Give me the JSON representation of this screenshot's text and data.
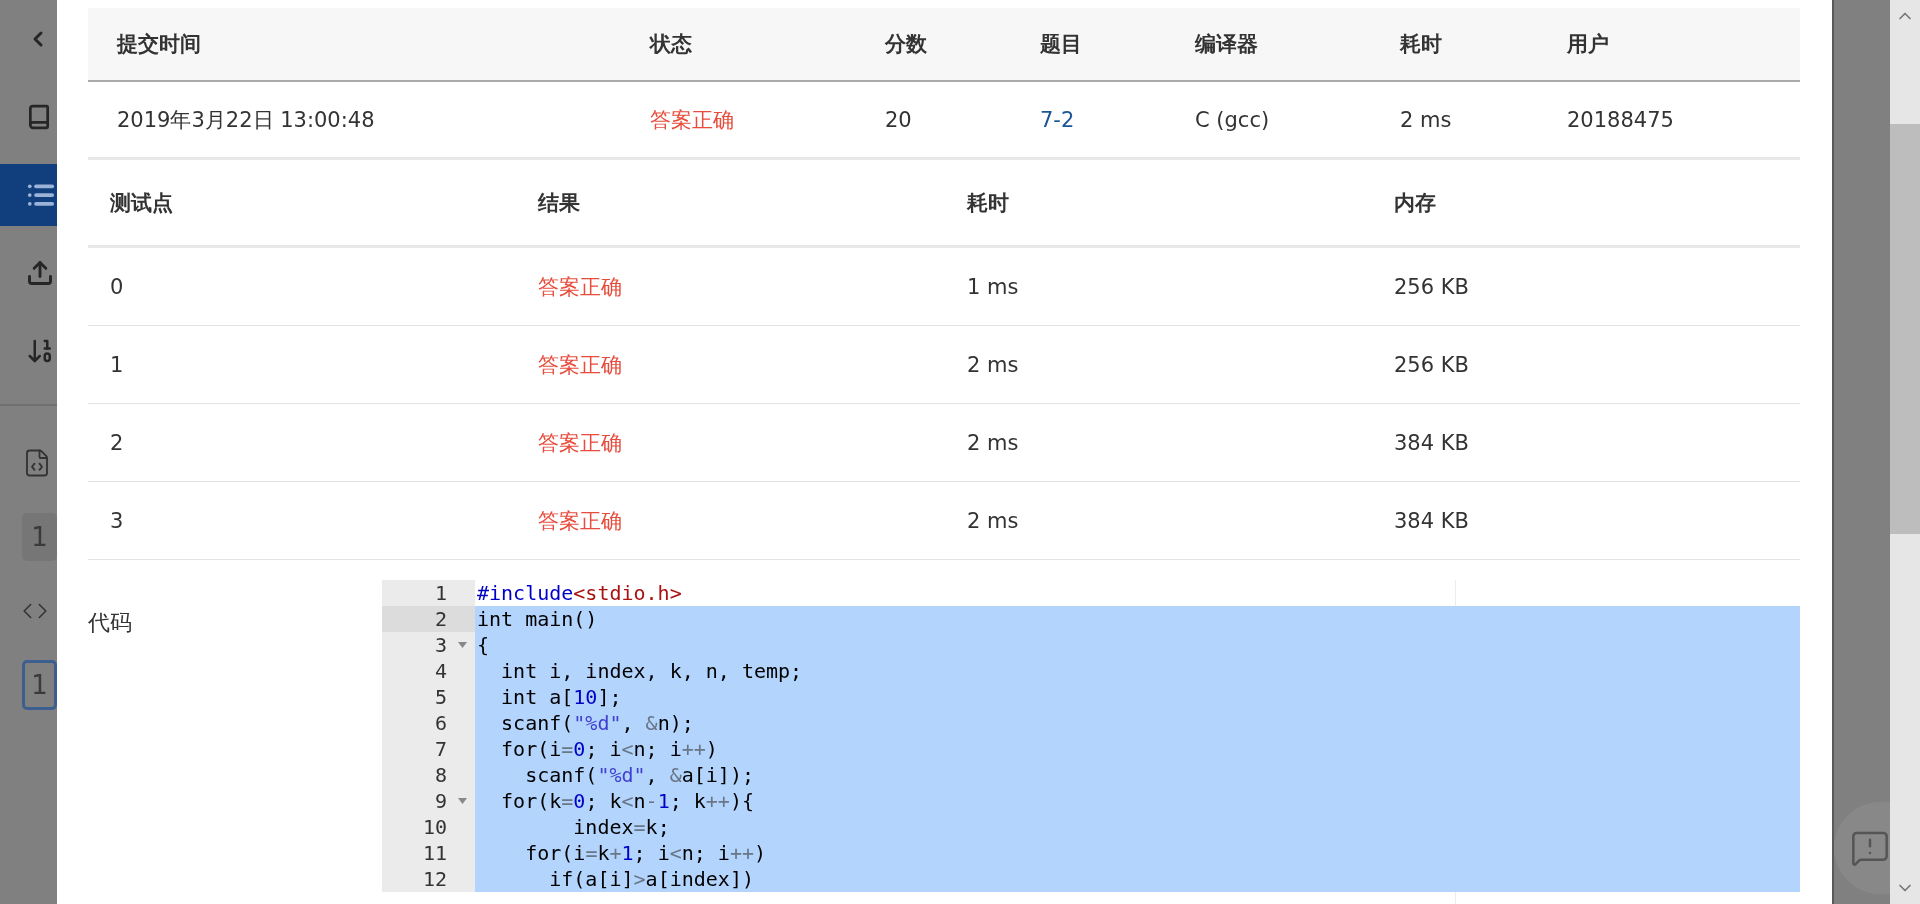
{
  "sidebar": {
    "items": [
      {
        "kind": "back",
        "selected": false
      },
      {
        "kind": "book",
        "selected": false
      },
      {
        "kind": "list",
        "selected": true
      },
      {
        "kind": "upload",
        "selected": false
      },
      {
        "kind": "sort",
        "selected": false
      }
    ],
    "lower_items": [
      {
        "kind": "file-code"
      },
      {
        "kind": "count",
        "label": "1",
        "selected": false
      },
      {
        "kind": "code"
      },
      {
        "kind": "count",
        "label": "1",
        "selected": true
      }
    ]
  },
  "submission_table": {
    "columns": [
      "提交时间",
      "状态",
      "分数",
      "题目",
      "编译器",
      "耗时",
      "用户"
    ],
    "rows": [
      {
        "cells": [
          {
            "kind": "text",
            "text": "2019年3月22日 13:00:48"
          },
          {
            "kind": "status",
            "text": "答案正确"
          },
          {
            "kind": "text",
            "text": "20"
          },
          {
            "kind": "link",
            "text": "7-2"
          },
          {
            "kind": "text",
            "text": "C (gcc)"
          },
          {
            "kind": "text",
            "text": "2 ms"
          },
          {
            "kind": "text",
            "text": "20188475"
          }
        ]
      }
    ]
  },
  "test_table": {
    "columns": [
      "测试点",
      "结果",
      "耗时",
      "内存"
    ],
    "rows": [
      {
        "cells": [
          {
            "kind": "text",
            "text": "0"
          },
          {
            "kind": "status",
            "text": "答案正确"
          },
          {
            "kind": "text",
            "text": "1 ms"
          },
          {
            "kind": "text",
            "text": "256 KB"
          }
        ]
      },
      {
        "cells": [
          {
            "kind": "text",
            "text": "1"
          },
          {
            "kind": "status",
            "text": "答案正确"
          },
          {
            "kind": "text",
            "text": "2 ms"
          },
          {
            "kind": "text",
            "text": "256 KB"
          }
        ]
      },
      {
        "cells": [
          {
            "kind": "text",
            "text": "2"
          },
          {
            "kind": "status",
            "text": "答案正确"
          },
          {
            "kind": "text",
            "text": "2 ms"
          },
          {
            "kind": "text",
            "text": "384 KB"
          }
        ]
      },
      {
        "cells": [
          {
            "kind": "text",
            "text": "3"
          },
          {
            "kind": "status",
            "text": "答案正确"
          },
          {
            "kind": "text",
            "text": "2 ms"
          },
          {
            "kind": "text",
            "text": "384 KB"
          }
        ]
      }
    ]
  },
  "code": {
    "label": "代码",
    "lines": [
      {
        "number": "1",
        "fold": false,
        "active": false,
        "selected": false,
        "text": "#include<stdio.h>"
      },
      {
        "number": "2",
        "fold": false,
        "active": true,
        "selected": true,
        "text": "int main()"
      },
      {
        "number": "3",
        "fold": true,
        "active": false,
        "selected": true,
        "text": "{"
      },
      {
        "number": "4",
        "fold": false,
        "active": false,
        "selected": true,
        "text": "  int i, index, k, n, temp;"
      },
      {
        "number": "5",
        "fold": false,
        "active": false,
        "selected": true,
        "text": "  int a[10];"
      },
      {
        "number": "6",
        "fold": false,
        "active": false,
        "selected": true,
        "text": "  scanf(\"%d\", &n);"
      },
      {
        "number": "7",
        "fold": false,
        "active": false,
        "selected": true,
        "text": "  for(i=0; i<n; i++)"
      },
      {
        "number": "8",
        "fold": false,
        "active": false,
        "selected": true,
        "text": "    scanf(\"%d\", &a[i]);"
      },
      {
        "number": "9",
        "fold": true,
        "active": false,
        "selected": true,
        "text": "  for(k=0; k<n-1; k++){"
      },
      {
        "number": "10",
        "fold": false,
        "active": false,
        "selected": true,
        "text": "        index=k;"
      },
      {
        "number": "11",
        "fold": false,
        "active": false,
        "selected": true,
        "text": "    for(i=k+1; i<n; i++)"
      },
      {
        "number": "12",
        "fold": false,
        "active": false,
        "selected": true,
        "text": "      if(a[i]>a[index])"
      }
    ]
  }
}
